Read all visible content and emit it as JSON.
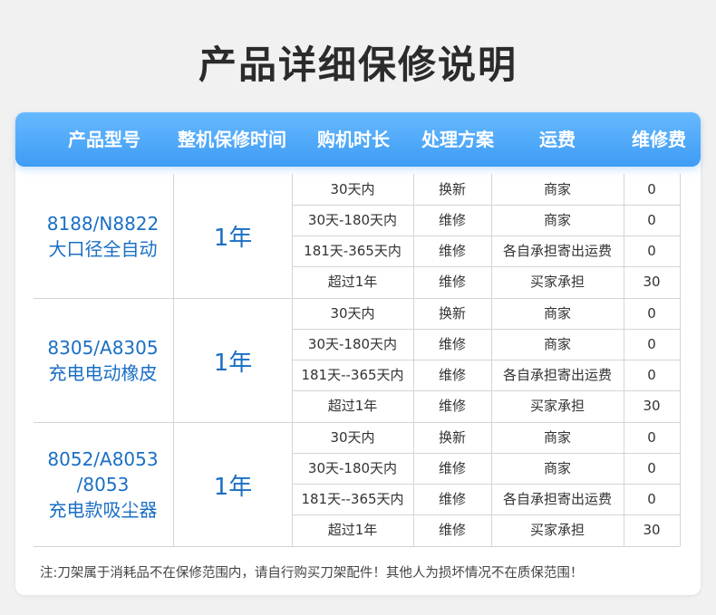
{
  "page": {
    "title": "产品详细保修说明"
  },
  "table": {
    "headers": [
      "产品型号",
      "整机保修时间",
      "购机时长",
      "处理方案",
      "运费",
      "维修费"
    ],
    "groups": [
      {
        "model_lines": [
          "8188/N8822",
          "大口径全自动"
        ],
        "period": "1年",
        "rows": [
          {
            "duration": "30天内",
            "solution": "换新",
            "shipping": "商家",
            "fee": "0"
          },
          {
            "duration": "30天-180天内",
            "solution": "维修",
            "shipping": "商家",
            "fee": "0"
          },
          {
            "duration": "181天-365天内",
            "solution": "维修",
            "shipping": "各自承担寄出运费",
            "fee": "0"
          },
          {
            "duration": "超过1年",
            "solution": "维修",
            "shipping": "买家承担",
            "fee": "30"
          }
        ]
      },
      {
        "model_lines": [
          "8305/A8305",
          "充电电动橡皮"
        ],
        "period": "1年",
        "rows": [
          {
            "duration": "30天内",
            "solution": "换新",
            "shipping": "商家",
            "fee": "0"
          },
          {
            "duration": "30天-180天内",
            "solution": "维修",
            "shipping": "商家",
            "fee": "0"
          },
          {
            "duration": "181天--365天内",
            "solution": "维修",
            "shipping": "各自承担寄出运费",
            "fee": "0"
          },
          {
            "duration": "超过1年",
            "solution": "维修",
            "shipping": "买家承担",
            "fee": "30"
          }
        ]
      },
      {
        "model_lines": [
          "8052/A8053",
          "/8053",
          "充电款吸尘器"
        ],
        "period": "1年",
        "rows": [
          {
            "duration": "30天内",
            "solution": "换新",
            "shipping": "商家",
            "fee": "0"
          },
          {
            "duration": "30天-180天内",
            "solution": "维修",
            "shipping": "商家",
            "fee": "0"
          },
          {
            "duration": "181天--365天内",
            "solution": "维修",
            "shipping": "各自承担寄出运费",
            "fee": "0"
          },
          {
            "duration": "超过1年",
            "solution": "维修",
            "shipping": "买家承担",
            "fee": "30"
          }
        ]
      }
    ]
  },
  "note": "注:刀架属于消耗品不在保修范围内，请自行购买刀架配件！其他人为损坏情况不在质保范围！",
  "colors": {
    "header_gradient_top": "#66b9ff",
    "header_gradient_bottom": "#3e9cf4",
    "model_text": "#1a6fc4"
  }
}
